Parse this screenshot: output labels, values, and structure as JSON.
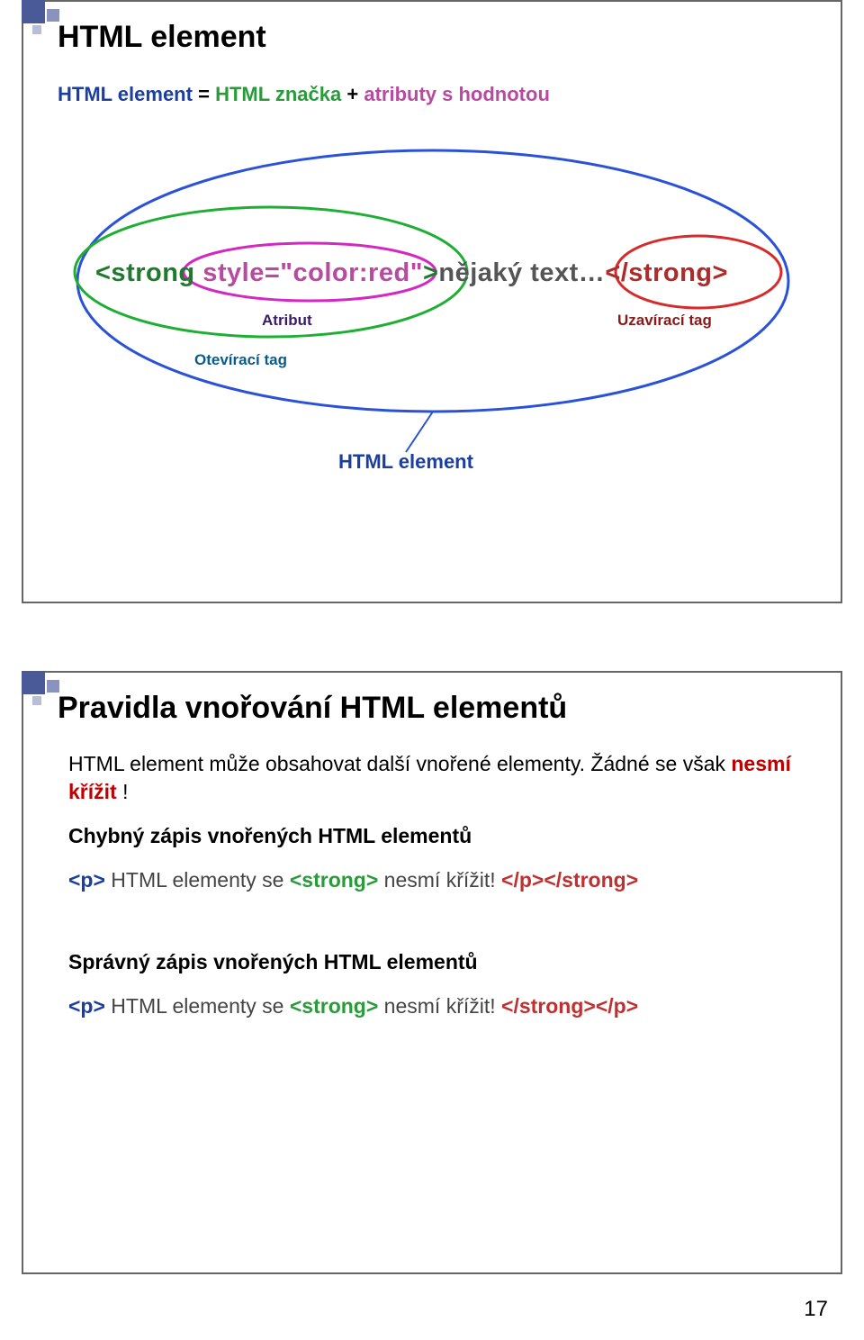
{
  "page_number": "17",
  "slide1": {
    "title": "HTML element",
    "formula": {
      "term1": "HTML element",
      "eq": "=",
      "term2": "HTML značka",
      "plus": "+",
      "term3": "atributy s hodnotou"
    },
    "diagram": {
      "code_open": "<strong",
      "code_space": " ",
      "code_attr": "style=\"color:red\"",
      "code_gt": ">",
      "code_text": "nějaký text…",
      "code_close": "</strong>",
      "label_attribute": "Atribut",
      "label_closing_tag": "Uzavírací tag",
      "label_opening_tag": "Otevírací tag",
      "label_html_element": "HTML element"
    }
  },
  "slide2": {
    "title": "Pravidla vnořování HTML elementů",
    "intro_a": "HTML element může obsahovat další vnořené elementy. Žádné se však ",
    "intro_b": "nesmí křížit",
    "intro_c": " !",
    "wrong_heading": "Chybný zápis vnořených HTML elementů",
    "correct_heading": "Správný zápis vnořených HTML elementů",
    "ex": {
      "p_open": "<p>",
      "text_a": " HTML elementy se ",
      "strong_open": "<strong>",
      "text_b": " nesmí křížit! ",
      "wrong_end": "</p></strong>",
      "correct_end": "</strong></p>"
    }
  }
}
